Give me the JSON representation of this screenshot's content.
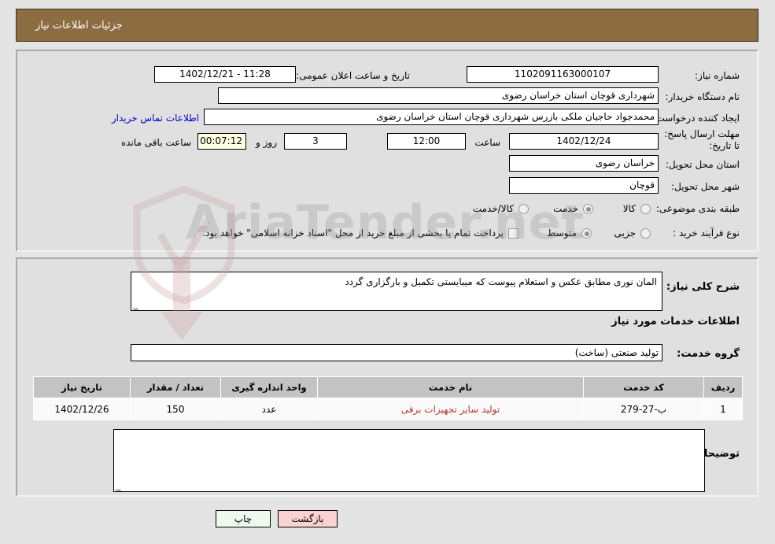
{
  "header": {
    "title": "جزئیات اطلاعات نیاز"
  },
  "form": {
    "labels": {
      "need_number": "شماره نیاز:",
      "buyer_org": "نام دستگاه خریدار:",
      "requester": "ایجاد کننده درخواست:",
      "deadline": "مهلت ارسال پاسخ: تا تاریخ:",
      "province": "استان محل تحویل:",
      "city": "شهر محل تحویل:",
      "category": "طبقه بندی موضوعی:",
      "process_type": "نوع فرآیند خرید :",
      "announce_datetime": "تاریخ و ساعت اعلان عمومی:",
      "hour": "ساعت",
      "day_and": "روز و",
      "remaining": "ساعت باقی مانده"
    },
    "values": {
      "need_number": "1102091163000107",
      "buyer_org": "شهرداری قوچان استان خراسان رضوی",
      "requester": "محمدجواد حاجیان ملکی بازرس شهرداری قوچان استان خراسان رضوی",
      "deadline_date": "1402/12/24",
      "deadline_hour": "12:00",
      "remaining_days": "3",
      "remaining_time": "00:07:12",
      "province": "خراسان رضوی",
      "city": "قوچان",
      "announce_datetime": "11:28 - 1402/12/21"
    },
    "contact_link": "اطلاعات تماس خریدار",
    "category_options": [
      {
        "label": "کالا",
        "selected": false
      },
      {
        "label": "خدمت",
        "selected": true
      },
      {
        "label": "کالا/خدمت",
        "selected": false
      }
    ],
    "process_options": [
      {
        "label": "جزیی",
        "selected": false
      },
      {
        "label": "متوسط",
        "selected": true
      }
    ],
    "treasury_checkbox": {
      "checked": false,
      "label": "پرداخت تمام یا بخشی از مبلغ خرید از محل \"اسناد خزانه اسلامی\" خواهد بود."
    }
  },
  "details": {
    "need_description_label": "شرح کلی نیاز:",
    "need_description_value": "المان نوری مطابق عکس و استعلام پیوست که میبایستی تکمیل و بارگزاری گردد",
    "services_heading": "اطلاعات خدمات مورد نیاز",
    "service_group_label": "گروه خدمت:",
    "service_group_value": "تولید صنعتی (ساخت)",
    "buyer_notes_label": "توضیحات خریدار:",
    "buyer_notes_value": ""
  },
  "table": {
    "columns": [
      "ردیف",
      "کد خدمت",
      "نام خدمت",
      "واحد اندازه گیری",
      "تعداد / مقدار",
      "تاریخ نیاز"
    ],
    "rows": [
      {
        "row_no": "1",
        "service_code": "ب-27-279",
        "service_name": "تولید سایر تجهیزات برقی",
        "unit": "عدد",
        "quantity": "150",
        "need_date": "1402/12/26"
      }
    ]
  },
  "footer": {
    "print_label": "چاپ",
    "back_label": "بازگشت"
  },
  "watermark": {
    "text": "AriaTender.net"
  },
  "colors": {
    "header_bg": "#8c6d42",
    "panel_bg": "#e0e0e0",
    "page_bg": "#e4e4e4",
    "link": "#0000cc",
    "table_header_bg": "#c3c3c3",
    "service_name_text": "#b03a2e",
    "countdown_bg": "#ffffe4",
    "print_btn_bg": "#eefaee",
    "back_btn_bg": "#fbd2d2"
  }
}
